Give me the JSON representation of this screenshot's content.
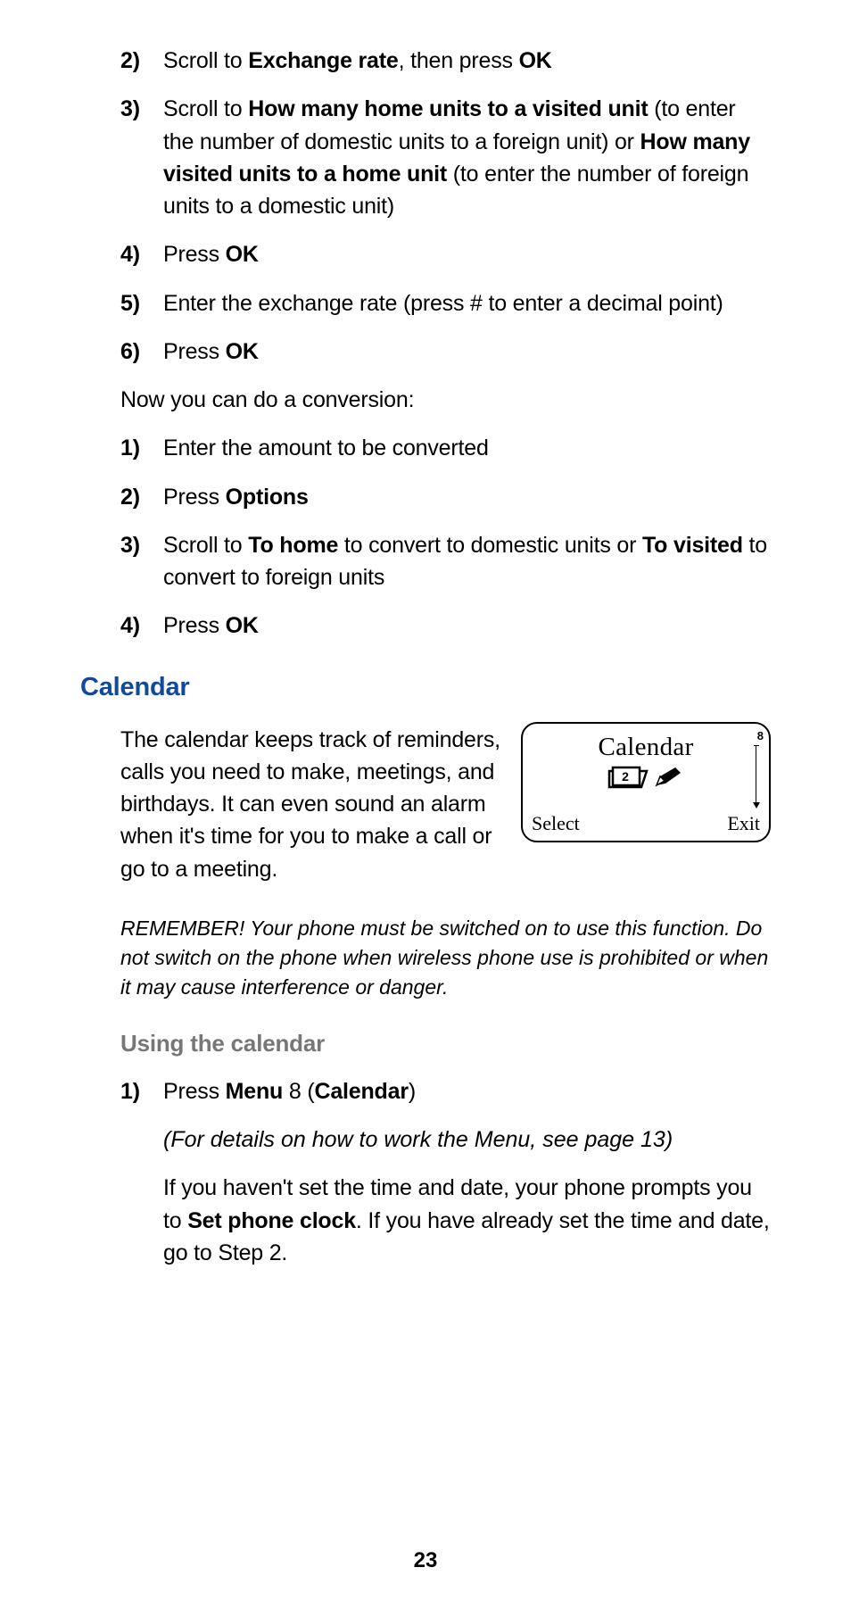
{
  "listA": {
    "step2": {
      "num": "2)",
      "pre": "Scroll to ",
      "bold1": "Exchange rate",
      "mid": ", then press ",
      "bold2": "OK"
    },
    "step3": {
      "num": "3)",
      "pre": "Scroll to ",
      "bold1": "How many home units to a visited unit",
      "mid1": " (to enter the number of domestic units to a foreign unit) or ",
      "bold2": "How many visited units to a home unit",
      "mid2": " (to enter the number of foreign units to a domestic unit)"
    },
    "step4": {
      "num": "4)",
      "pre": "Press ",
      "bold1": "OK"
    },
    "step5": {
      "num": "5)",
      "text": "Enter the exchange rate (press # to enter a decimal point)"
    },
    "step6": {
      "num": "6)",
      "pre": "Press ",
      "bold1": "OK"
    }
  },
  "bridge": "Now you can do a conversion:",
  "listB": {
    "step1": {
      "num": "1)",
      "text": "Enter the amount to be converted"
    },
    "step2": {
      "num": "2)",
      "pre": "Press ",
      "bold1": "Options"
    },
    "step3": {
      "num": "3)",
      "pre": "Scroll to ",
      "bold1": "To home",
      "mid1": " to convert to domestic units or ",
      "bold2": "To visited",
      "mid2": " to convert to foreign units"
    },
    "step4": {
      "num": "4)",
      "pre": "Press ",
      "bold1": "OK"
    }
  },
  "calendar": {
    "heading": "Calendar",
    "intro": "The calendar keeps track of reminders, calls you need to make, meetings, and birthdays. It can even sound an alarm when it's time for you to make a call or go to a meeting.",
    "remember": "REMEMBER! Your phone must be switched on to use this function. Do not switch on the phone when wireless phone use is prohibited or when it may cause interference or danger.",
    "screen": {
      "title": "Calendar",
      "menu_number": "8",
      "select": "Select",
      "exit": "Exit"
    },
    "using_heading": "Using the calendar",
    "step1": {
      "num": "1)",
      "pre": "Press ",
      "bold1": "Menu",
      "mid": " 8 (",
      "bold2": "Calendar",
      "post": ")"
    },
    "step1_note": "(For details on how to work the Menu, see page 13)",
    "step1_text_pre": "If you haven't set the time and date, your phone prompts you to ",
    "step1_text_bold": "Set phone clock",
    "step1_text_post": ". If you have already set the time and date, go to Step 2."
  },
  "page_number": "23"
}
